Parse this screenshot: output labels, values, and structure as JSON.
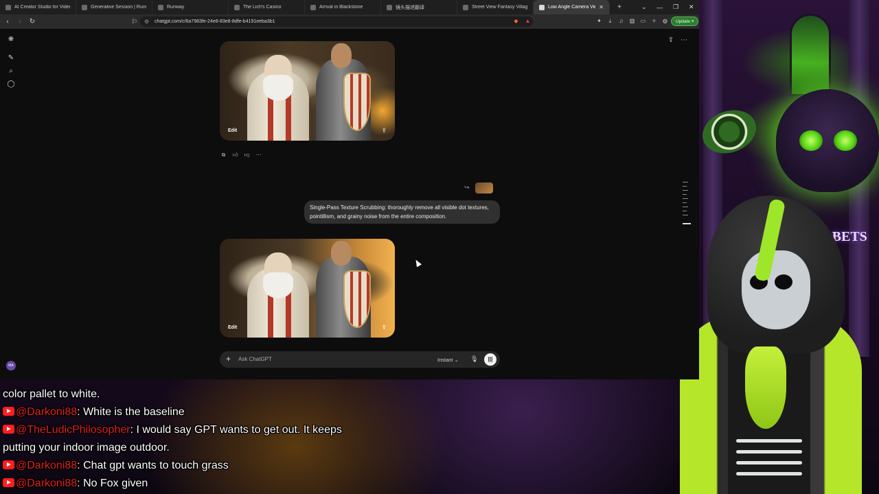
{
  "browser": {
    "tabs": [
      {
        "label": "AI Creator Studio for Video &",
        "active": false
      },
      {
        "label": "Generative Session | Runway",
        "active": false
      },
      {
        "label": "Runway",
        "active": false
      },
      {
        "label": "The Lich's Casino",
        "active": false
      },
      {
        "label": "Arrival in Blackstone",
        "active": false
      },
      {
        "label": "镜头描述翻译",
        "active": false
      },
      {
        "label": "Street View Fantasy Village",
        "active": false
      },
      {
        "label": "Low Angle Camera View",
        "active": true
      }
    ],
    "url": "chatgpt.com/c/6a7983fe-24e8-83e8-8dfe-b4191eeba3b1",
    "update_label": "Update"
  },
  "chatgpt": {
    "user_initials": "MA",
    "images": [
      {
        "edit_label": "Edit"
      },
      {
        "edit_label": "Edit"
      }
    ],
    "user_message": "Single-Pass Texture Scrubbing: thoroughly remove all visible dot textures, pointillism, and grainy noise from the entire composition.",
    "composer": {
      "placeholder": "Ask ChatGPT",
      "mode": "Instant"
    }
  },
  "overlay": {
    "sign_text": "& BETS",
    "chat": [
      {
        "user": "",
        "text": "color pallet to white."
      },
      {
        "user": "@Darkoni88",
        "text": ": White is the baseline"
      },
      {
        "user": "@TheLudicPhilosopher",
        "text": ": I would say GPT wants to get out. It keeps"
      },
      {
        "user": "",
        "text": "putting your indoor image outdoor."
      },
      {
        "user": "@Darkoni88",
        "text": ": Chat gpt wants to touch grass"
      },
      {
        "user": "@Darkoni88",
        "text": ": No Fox given"
      }
    ]
  },
  "colors": {
    "accent_green": "#9ee62a",
    "yt_red": "#ff1e1e",
    "chat_username": "#e02020",
    "update_button": "#2e7d32"
  }
}
